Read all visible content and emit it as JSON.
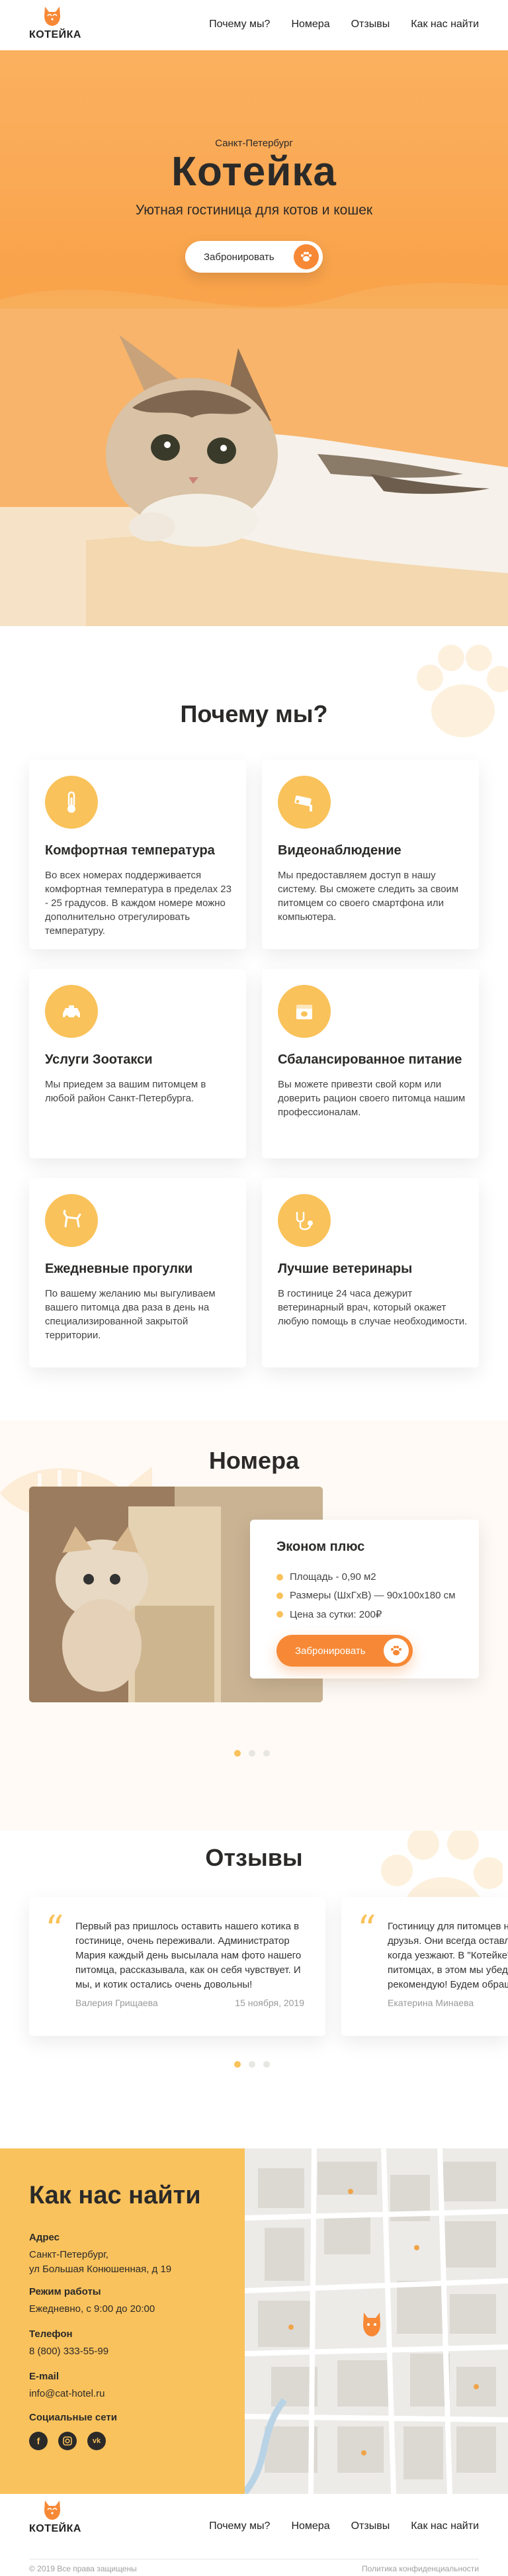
{
  "colors": {
    "accent_orange": "#f78936",
    "accent_yellow": "#f9c25a",
    "hero_bg": "#f9a34b",
    "contacts_bg": "#fac25c",
    "text_dark": "#2b2a29"
  },
  "header": {
    "logo_text": "КОТЕЙКА",
    "nav": [
      "Почему мы?",
      "Номера",
      "Отзывы",
      "Как нас найти"
    ]
  },
  "hero": {
    "city": "Санкт-Петербург",
    "title": "Котейка",
    "tagline": "Уютная гостиница для котов и кошек",
    "button_label": "Забронировать"
  },
  "why": {
    "title": "Почему мы?",
    "cards": [
      {
        "icon": "thermometer-icon",
        "title": "Комфортная температура",
        "text": "Во всех номерах поддерживается комфортная температура в пределах 23 - 25 градусов. В каждом номере можно дополнительно отрегулировать температуру."
      },
      {
        "icon": "camera-icon",
        "title": "Видеонаблюдение",
        "text": "Мы предоставляем доступ в нашу систему. Вы сможете следить за своим питомцем со своего смартфона или компьютера."
      },
      {
        "icon": "taxi-icon",
        "title": "Услуги Зоотакси",
        "text": "Мы приедем за вашим питомцем в любой район Санкт-Петербурга."
      },
      {
        "icon": "food-icon",
        "title": "Сбалансированное питание",
        "text": "Вы можете привезти свой корм или доверить рацион своего питомца нашим профессионалам."
      },
      {
        "icon": "walking-cat-icon",
        "title": "Ежедневные прогулки",
        "text": "По вашему желанию мы выгуливаем вашего питомца два раза в день на специализированной закрытой территории."
      },
      {
        "icon": "vet-icon",
        "title": "Лучшие ветеринары",
        "text": "В гостинице 24 часа дежурит ветеринарный врач, который окажет любую помощь в случае необходимости."
      }
    ]
  },
  "rooms": {
    "title": "Номера",
    "room_name": "Эконом плюс",
    "features": [
      "Площадь - 0,90 м2",
      "Размеры (ШхГхВ) — 90х100х180 см",
      "Цена за сутки: 200₽"
    ],
    "button_label": "Забронировать",
    "slides": 3,
    "active_slide": 1
  },
  "reviews": {
    "title": "Отзывы",
    "items": [
      {
        "text": "Первый раз пришлось оставить нашего котика в гостинице, очень переживали. Администратор Мария каждый день высылала нам фото нашего питомца, рассказывала, как он себя чувствует. И мы, и котик остались очень довольны!",
        "name": "Валерия Грищаева",
        "date": "15 ноября, 2019"
      },
      {
        "text": "Гостиницу для питомцев нам посоветовали друзья. Они всегда оставляют здесь своего кота, когда уезжают. В \"Котейке\" отлично заботятся о питомцах, в этом мы убедились. Всем рекомендую! Будем обращаться еще!",
        "name": "Екатерина Минаева",
        "date": ""
      }
    ],
    "slides": 3,
    "active_slide": 1
  },
  "contacts": {
    "title": "Как нас найти",
    "address_label": "Адрес",
    "address_line1": "Санкт-Петербург,",
    "address_line2": "ул Большая Конюшенная, д 19",
    "hours_label": "Режим работы",
    "hours_value": "Ежедневно, с 9:00 до 20:00",
    "phone_label": "Телефон",
    "phone_value": "8 (800) 333-55-99",
    "email_label": "E-mail",
    "email_value": "info@cat-hotel.ru",
    "social_label": "Социальные сети",
    "socials": [
      "facebook-icon",
      "instagram-icon",
      "vk-icon"
    ]
  },
  "footer": {
    "logo_text": "КОТЕЙКА",
    "nav": [
      "Почему мы?",
      "Номера",
      "Отзывы",
      "Как нас найти"
    ],
    "copyright": "© 2019 Все права защищены",
    "policy": "Политика конфиденциальности"
  }
}
